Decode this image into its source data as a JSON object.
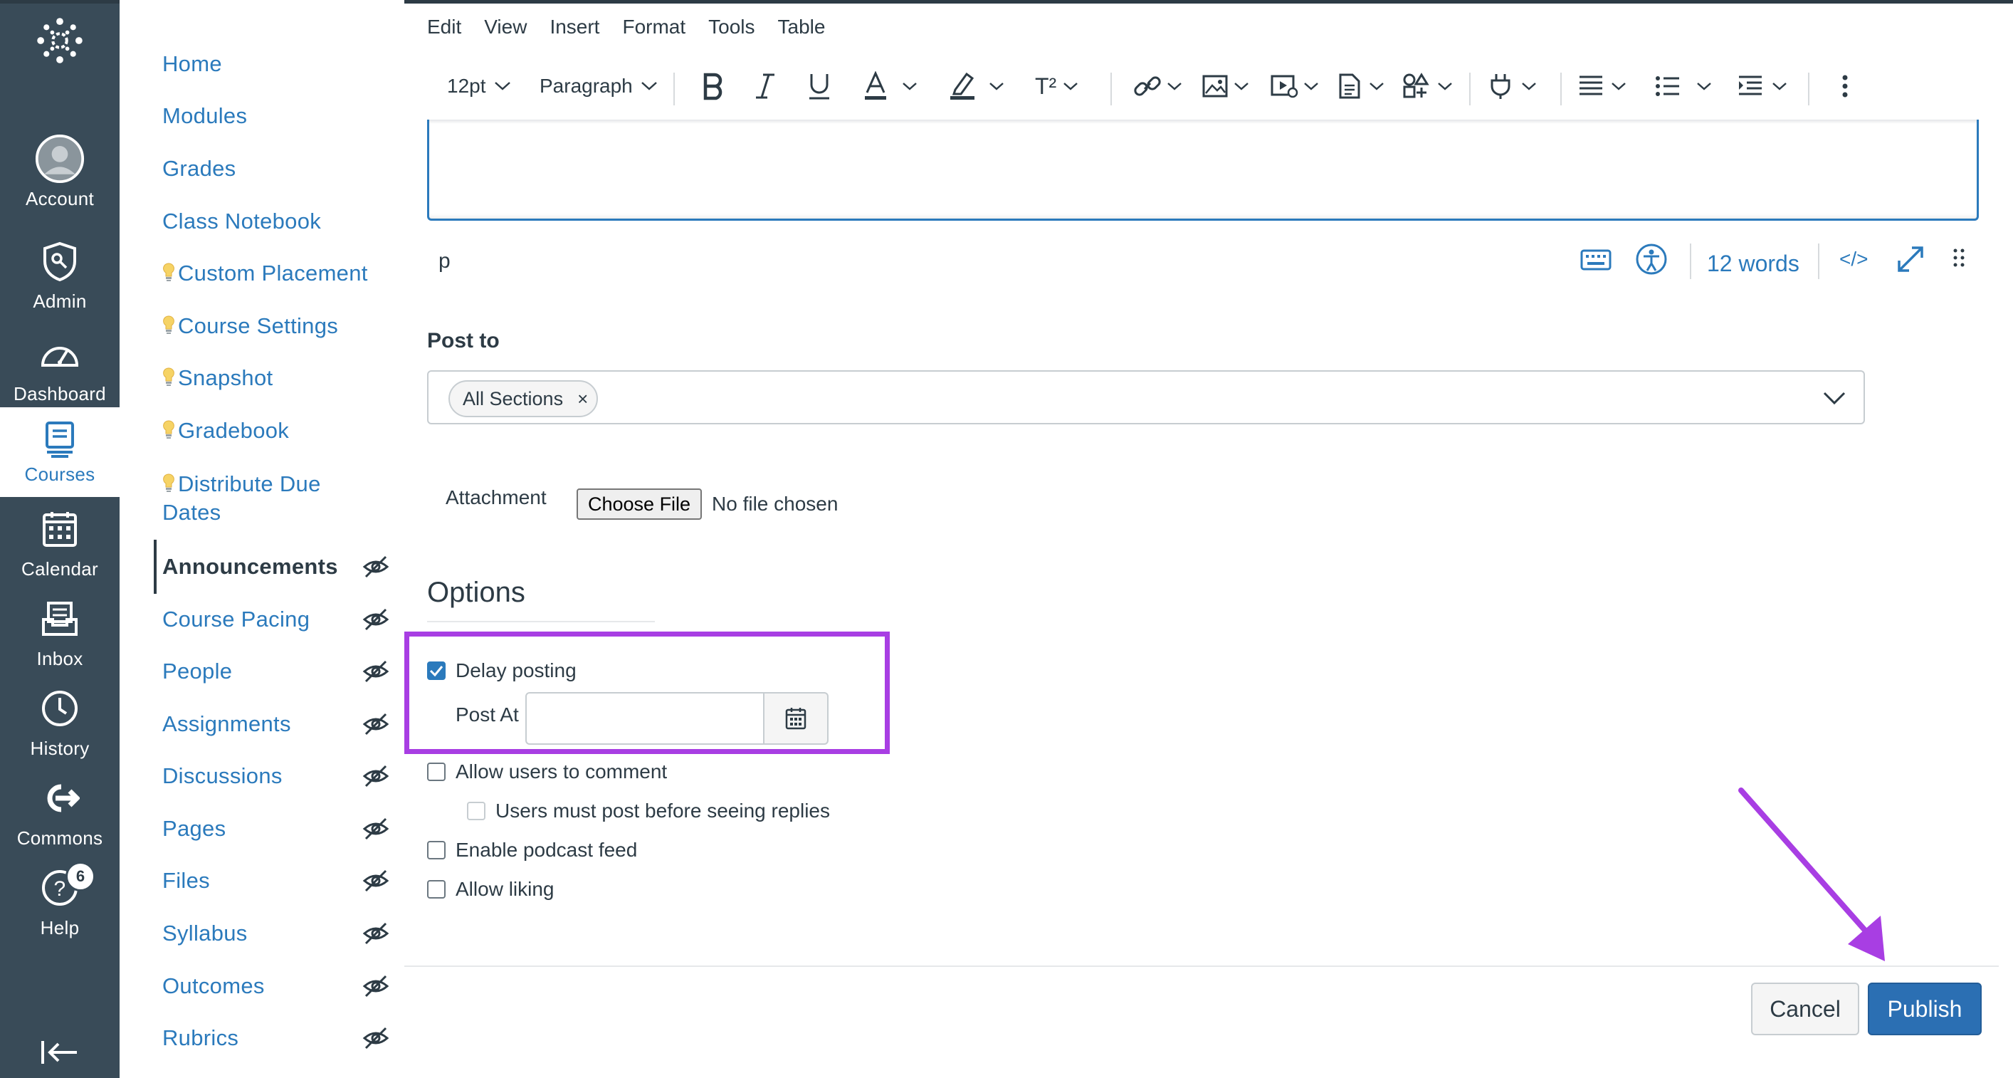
{
  "colors": {
    "nav_bg": "#394b58",
    "link": "#2b7abc",
    "text": "#2d3b45",
    "highlight": "#a83ee3",
    "publish_bg": "#2b6fb3"
  },
  "global_nav": {
    "items": [
      {
        "label": "Account",
        "icon": "avatar-icon"
      },
      {
        "label": "Admin",
        "icon": "shield-icon"
      },
      {
        "label": "Dashboard",
        "icon": "speedometer-icon"
      },
      {
        "label": "Courses",
        "icon": "book-icon",
        "active": true
      },
      {
        "label": "Calendar",
        "icon": "calendar-icon"
      },
      {
        "label": "Inbox",
        "icon": "inbox-icon"
      },
      {
        "label": "History",
        "icon": "clock-icon"
      },
      {
        "label": "Commons",
        "icon": "commons-icon"
      },
      {
        "label": "Help",
        "icon": "help-icon"
      }
    ],
    "help_badge": "6",
    "collapse_icon": "collapse-arrow-icon"
  },
  "course_nav": {
    "items": [
      {
        "label": "Home"
      },
      {
        "label": "Modules"
      },
      {
        "label": "Grades"
      },
      {
        "label": "Class Notebook"
      },
      {
        "label": "Custom Placement",
        "bulb": true
      },
      {
        "label": "Course Settings",
        "bulb": true
      },
      {
        "label": "Snapshot",
        "bulb": true
      },
      {
        "label": "Gradebook",
        "bulb": true
      },
      {
        "label": "Distribute Due",
        "label2": "Dates",
        "bulb": true
      },
      {
        "label": "Announcements",
        "active": true,
        "hidden_eye": true
      },
      {
        "label": "Course Pacing",
        "hidden_eye": true
      },
      {
        "label": "People",
        "hidden_eye": true
      },
      {
        "label": "Assignments",
        "hidden_eye": true
      },
      {
        "label": "Discussions",
        "hidden_eye": true
      },
      {
        "label": "Pages",
        "hidden_eye": true
      },
      {
        "label": "Files",
        "hidden_eye": true
      },
      {
        "label": "Syllabus",
        "hidden_eye": true
      },
      {
        "label": "Outcomes",
        "hidden_eye": true
      },
      {
        "label": "Rubrics",
        "hidden_eye": true
      }
    ]
  },
  "editor": {
    "menu": [
      "Edit",
      "View",
      "Insert",
      "Format",
      "Tools",
      "Table"
    ],
    "toolbar": {
      "font_size": "12pt",
      "block_format": "Paragraph",
      "superscript_label": "T²",
      "icons": [
        "bold-icon",
        "italic-icon",
        "underline-icon",
        "text-color-icon",
        "highlight-color-icon",
        "superscript-icon",
        "link-icon",
        "image-icon",
        "media-icon",
        "document-icon",
        "apps-icon",
        "plugin-icon",
        "align-icon",
        "bullet-list-icon",
        "indent-icon",
        "more-icon"
      ]
    },
    "status_path": "p",
    "word_count": "12 words",
    "html_toggle": "</>",
    "status_icons": [
      "keyboard-icon",
      "accessibility-icon",
      "html-editor-icon",
      "fullscreen-icon",
      "resize-handle-icon"
    ]
  },
  "form": {
    "post_to_label": "Post to",
    "post_to_pill": "All Sections",
    "pill_remove": "×",
    "attachment_label": "Attachment",
    "choose_file": "Choose File",
    "no_file": "No file chosen",
    "options_heading": "Options",
    "delay_posting": {
      "label": "Delay posting",
      "checked": true
    },
    "post_at_label": "Post At",
    "post_at_value": "",
    "allow_comment": {
      "label": "Allow users to comment",
      "checked": false
    },
    "must_post": {
      "label": "Users must post before seeing replies",
      "checked": false,
      "disabled": true
    },
    "podcast": {
      "label": "Enable podcast feed",
      "checked": false
    },
    "liking": {
      "label": "Allow liking",
      "checked": false
    }
  },
  "actions": {
    "cancel": "Cancel",
    "publish": "Publish"
  }
}
